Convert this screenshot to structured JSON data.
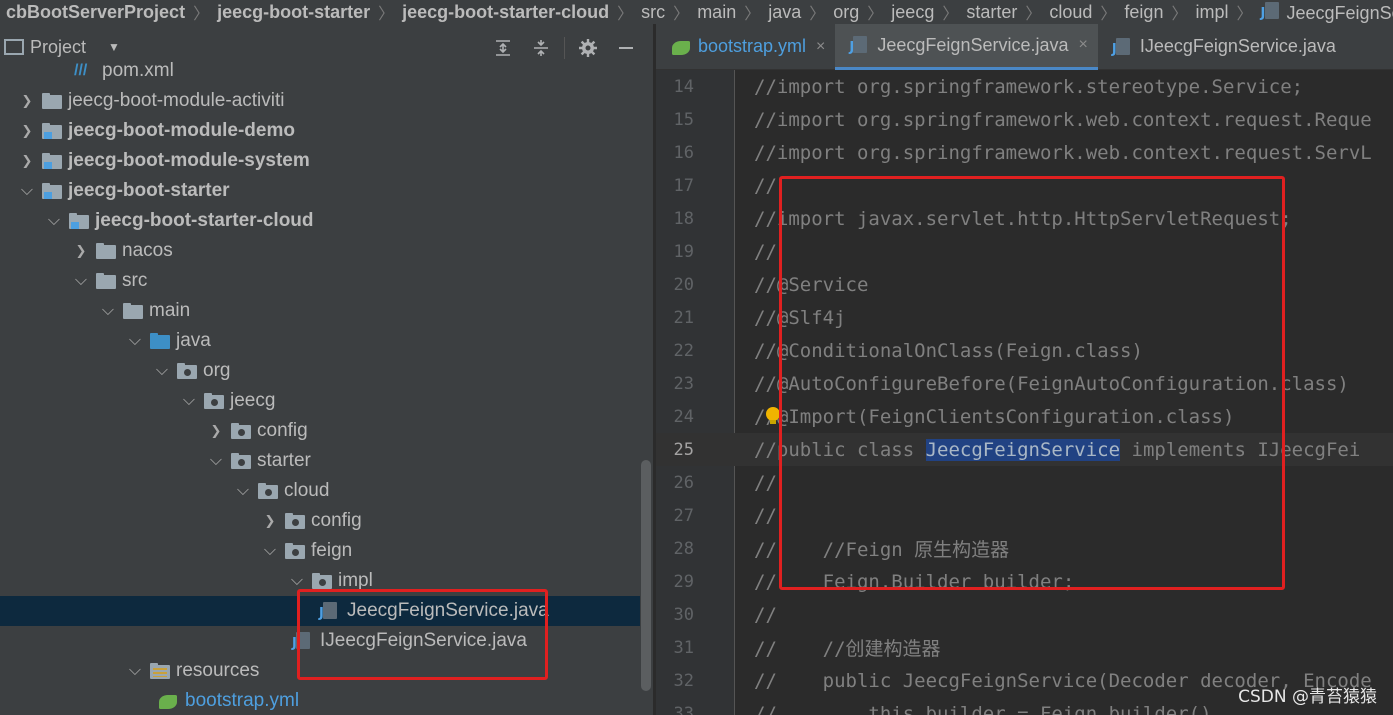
{
  "breadcrumbs": [
    "cbBootServerProject",
    "jeecg-boot-starter",
    "jeecg-boot-starter-cloud",
    "src",
    "main",
    "java",
    "org",
    "jeecg",
    "starter",
    "cloud",
    "feign",
    "impl",
    "JeecgFeignServic"
  ],
  "project_panel": {
    "title": "Project",
    "tools": [
      "expand-all-icon",
      "collapse-all-icon",
      "gear-icon",
      "minimize-icon"
    ]
  },
  "tree": [
    {
      "label": "pom.xml",
      "indent": 0,
      "icon": "pom",
      "arrow": ""
    },
    {
      "label": "jeecg-boot-module-activiti",
      "icon": "folder",
      "arrow": "›",
      "bold": false
    },
    {
      "label": "jeecg-boot-module-demo",
      "icon": "module",
      "arrow": "›",
      "bold": true
    },
    {
      "label": "jeecg-boot-module-system",
      "icon": "module",
      "arrow": "›",
      "bold": true
    },
    {
      "label": "jeecg-boot-starter",
      "icon": "module",
      "arrow": "⌄",
      "bold": true
    },
    {
      "label": "jeecg-boot-starter-cloud",
      "icon": "module",
      "arrow": "⌄",
      "bold": true
    },
    {
      "label": "nacos",
      "icon": "folder",
      "arrow": "›"
    },
    {
      "label": "src",
      "icon": "folder",
      "arrow": "⌄"
    },
    {
      "label": "main",
      "icon": "folder",
      "arrow": "⌄"
    },
    {
      "label": "java",
      "icon": "blue",
      "arrow": "⌄"
    },
    {
      "label": "org",
      "icon": "pkg",
      "arrow": "⌄"
    },
    {
      "label": "jeecg",
      "icon": "pkg",
      "arrow": "⌄"
    },
    {
      "label": "config",
      "icon": "pkg",
      "arrow": "›"
    },
    {
      "label": "starter",
      "icon": "pkg",
      "arrow": "⌄"
    },
    {
      "label": "cloud",
      "icon": "pkg",
      "arrow": "⌄"
    },
    {
      "label": "config",
      "icon": "pkg",
      "arrow": "›"
    },
    {
      "label": "feign",
      "icon": "pkg",
      "arrow": "⌄"
    },
    {
      "label": "impl",
      "icon": "pkg",
      "arrow": "⌄"
    },
    {
      "label": "JeecgFeignService.java",
      "icon": "java",
      "arrow": "",
      "selected": true
    },
    {
      "label": "IJeecgFeignService.java",
      "icon": "java",
      "arrow": ""
    },
    {
      "label": "resources",
      "icon": "res",
      "arrow": "⌄"
    },
    {
      "label": "bootstrap.yml",
      "icon": "yml",
      "arrow": ""
    }
  ],
  "tabs": [
    {
      "label": "bootstrap.yml",
      "icon": "yml",
      "close": "×"
    },
    {
      "label": "JeecgFeignService.java",
      "icon": "java",
      "close": "×",
      "active": true
    },
    {
      "label": "IJeecgFeignService.java",
      "icon": "java",
      "close": ""
    }
  ],
  "code_lines": [
    {
      "n": "14",
      "text": "//import org.springframework.stereotype.Service;"
    },
    {
      "n": "15",
      "text": "//import org.springframework.web.context.request.Reque"
    },
    {
      "n": "16",
      "text": "//import org.springframework.web.context.request.ServL"
    },
    {
      "n": "17",
      "text": "//"
    },
    {
      "n": "18",
      "text": "//import javax.servlet.http.HttpServletRequest;"
    },
    {
      "n": "19",
      "text": "//"
    },
    {
      "n": "20",
      "text": "//@Service"
    },
    {
      "n": "21",
      "text": "//@Slf4j"
    },
    {
      "n": "22",
      "text": "//@ConditionalOnClass(Feign.class)"
    },
    {
      "n": "23",
      "text": "//@AutoConfigureBefore(FeignAutoConfiguration.class)"
    },
    {
      "n": "24",
      "text": "//@Import(FeignClientsConfiguration.class)"
    },
    {
      "n": "25",
      "pre": "//public class ",
      "hl": "JeecgFeignService",
      "post": " implements IJeecgFei",
      "current": true
    },
    {
      "n": "26",
      "text": "//"
    },
    {
      "n": "27",
      "text": "//"
    },
    {
      "n": "28",
      "text": "//    //Feign 原生构造器"
    },
    {
      "n": "29",
      "text": "//    Feign.Builder builder;"
    },
    {
      "n": "30",
      "text": "//"
    },
    {
      "n": "31",
      "text": "//    //创建构造器"
    },
    {
      "n": "32",
      "text": "//    public JeecgFeignService(Decoder decoder, Encode"
    },
    {
      "n": "33",
      "text": "//        this.builder = Feign.builder()"
    }
  ],
  "watermark": "CSDN @青苔猿猿",
  "colors": {
    "annotation": "#e02020",
    "selection": "#214283",
    "tree_selected": "#0d293e"
  }
}
